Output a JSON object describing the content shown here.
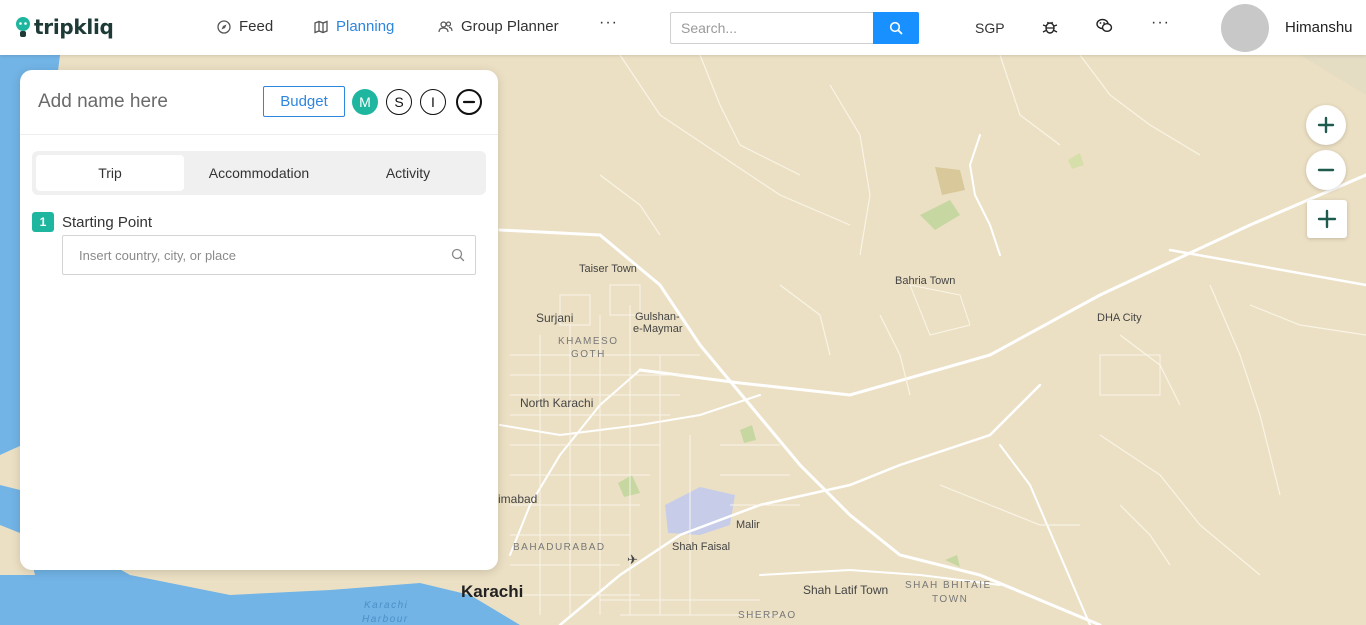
{
  "header": {
    "brand": "tripkliq",
    "nav": [
      {
        "label": "Feed",
        "icon": "compass-icon",
        "active": false
      },
      {
        "label": "Planning",
        "icon": "map-icon",
        "active": true
      },
      {
        "label": "Group Planner",
        "icon": "group-icon",
        "active": false
      }
    ],
    "more_label": "···",
    "search": {
      "placeholder": "Search..."
    },
    "currency": "SGP",
    "icons": [
      "bug-icon",
      "wechat-icon"
    ],
    "more_right_label": "···",
    "user": {
      "name": "Himanshu"
    }
  },
  "colors": {
    "accent": "#2e86de",
    "teal": "#1fb6a0",
    "search_button": "#1890ff",
    "map_land": "#ece0c4",
    "map_water": "#72b4e6"
  },
  "panel": {
    "name_placeholder": "Add name here",
    "budget_label": "Budget",
    "badges": [
      "M",
      "S",
      "I"
    ],
    "tabs": [
      {
        "label": "Trip",
        "selected": true
      },
      {
        "label": "Accommodation",
        "selected": false
      },
      {
        "label": "Activity",
        "selected": false
      }
    ],
    "step": {
      "number": "1",
      "label": "Starting Point",
      "placeholder": "Insert country, city, or place"
    }
  },
  "map": {
    "labels": {
      "taiser_town": "Taiser Town",
      "surjani": "Surjani",
      "gulshan": "Gulshan-",
      "gulshan2": "e-Maymar",
      "khameso": "KHAMESO",
      "goth": "GOTH",
      "north_karachi": "North Karachi",
      "bahria_town": "Bahria Town",
      "dha_city": "DHA City",
      "imabad": "imabad",
      "bahadurabad": "BAHADURABAD",
      "malir": "Malir",
      "shah_faisal": "Shah Faisal",
      "karachi": "Karachi",
      "karachi_harbour": "Karachi",
      "harbour": "Harbour",
      "shah_latif": "Shah Latif Town",
      "shah_bhitaie": "SHAH BHITAIE",
      "town": "TOWN",
      "sherpao": "SHERPAO"
    }
  }
}
